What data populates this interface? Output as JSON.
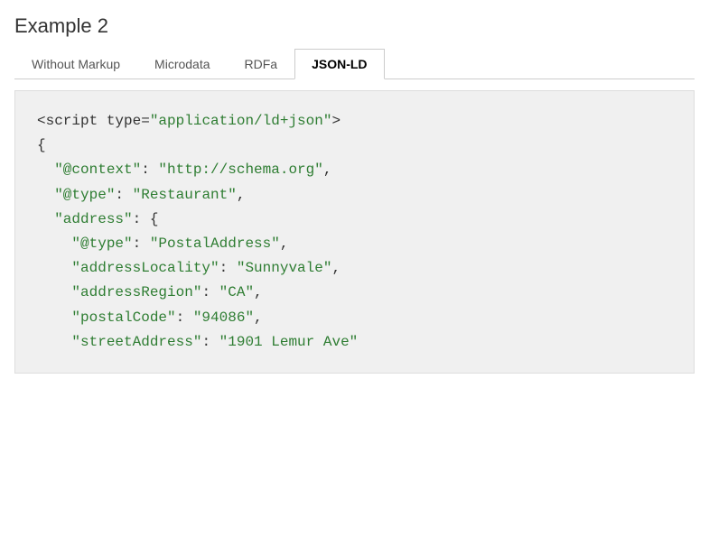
{
  "page": {
    "title": "Example 2"
  },
  "tabs": [
    {
      "id": "without-markup",
      "label": "Without Markup",
      "active": false
    },
    {
      "id": "microdata",
      "label": "Microdata",
      "active": false
    },
    {
      "id": "rdfa",
      "label": "RDFa",
      "active": false
    },
    {
      "id": "json-ld",
      "label": "JSON-LD",
      "active": true
    }
  ],
  "code": {
    "lines": [
      "<script type=\"application/ld+json\">",
      "{",
      "  \"@context\": \"http://schema.org\",",
      "  \"@type\": \"Restaurant\",",
      "  \"address\": {",
      "    \"@type\": \"PostalAddress\",",
      "    \"addressLocality\": \"Sunnyvale\",",
      "    \"addressRegion\": \"CA\",",
      "    \"postalCode\": \"94086\",",
      "    \"streetAddress\": \"1901 Lemur Ave\""
    ]
  }
}
